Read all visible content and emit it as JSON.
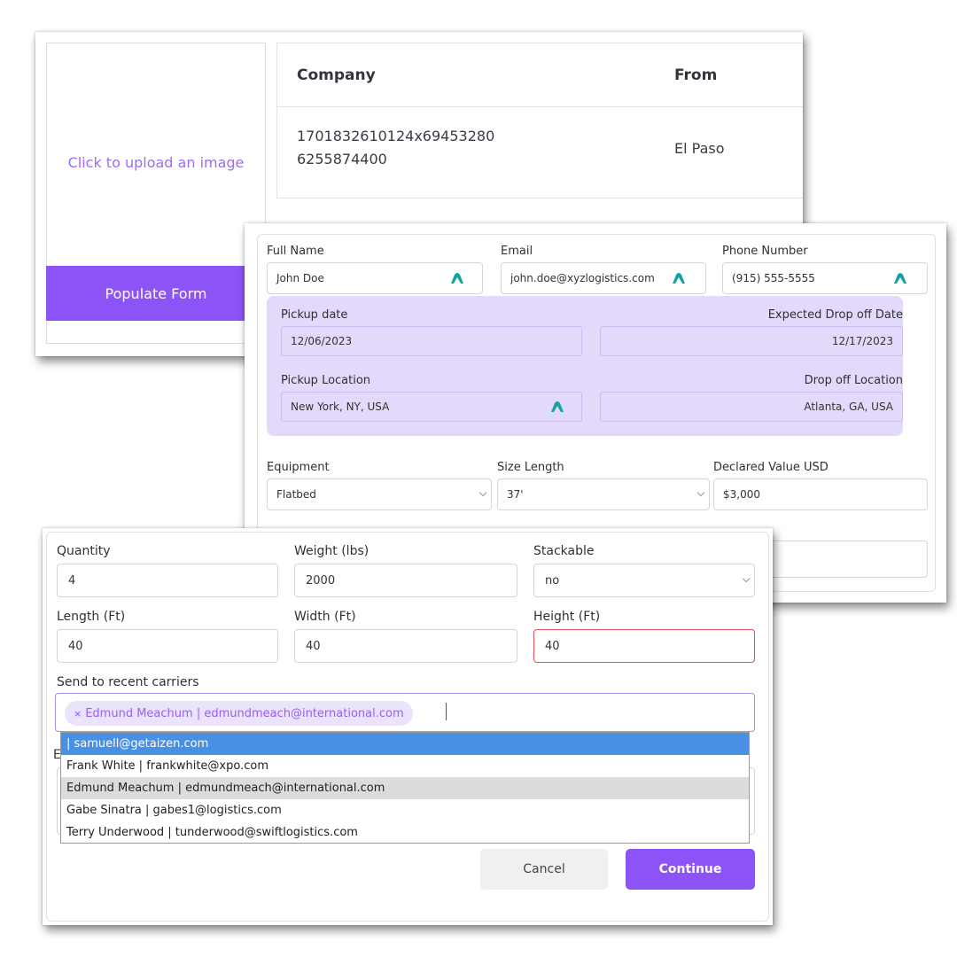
{
  "upload_panel": {
    "prompt": "Click to upload an image",
    "populate_button": "Populate Form"
  },
  "results_table": {
    "columns": [
      "Company",
      "From"
    ],
    "rows": [
      {
        "company_line1": "1701832610124x69453280",
        "company_line2": "6255874400",
        "from": "El Paso"
      }
    ]
  },
  "contact": {
    "full_name_label": "Full Name",
    "full_name": "John Doe",
    "email_label": "Email",
    "email": "john.doe@xyzlogistics.com",
    "phone_label": "Phone Number",
    "phone": "(915) 555-5555"
  },
  "schedule": {
    "pickup_date_label": "Pickup date",
    "pickup_date": "12/06/2023",
    "dropoff_date_label": "Expected Drop off Date",
    "dropoff_date": "12/17/2023",
    "pickup_location_label": "Pickup Location",
    "pickup_location": "New York, NY, USA",
    "dropoff_location_label": "Drop off Location",
    "dropoff_location": "Atlanta, GA, USA"
  },
  "shipment": {
    "equipment_label": "Equipment",
    "equipment": "Flatbed",
    "size_length_label": "Size Length",
    "size_length": "37'",
    "declared_value_label": "Declared Value USD",
    "declared_value": "$3,000"
  },
  "cargo": {
    "quantity_label": "Quantity",
    "quantity": "4",
    "weight_label": "Weight (lbs)",
    "weight": "2000",
    "stackable_label": "Stackable",
    "stackable": "no",
    "length_label": "Length (Ft)",
    "length": "40",
    "width_label": "Width (Ft)",
    "width": "40",
    "height_label": "Height (Ft)",
    "height": "40"
  },
  "carriers": {
    "label": "Send to recent carriers",
    "selected_chip": "Edmund Meachum | edmundmeach@international.com",
    "options": [
      "| samuell@getaizen.com",
      "Frank White | frankwhite@xpo.com",
      "Edmund Meachum | edmundmeach@international.com",
      "Gabe Sinatra | gabes1@logistics.com",
      "Terry Underwood | tunderwood@swiftlogistics.com"
    ],
    "hidden_label_fragment": "E"
  },
  "actions": {
    "cancel": "Cancel",
    "continue": "Continue"
  },
  "colors": {
    "accent": "#8c54f7",
    "panel": "#e2d9fb",
    "icon": "#17a2a2",
    "error": "#e34d5c",
    "highlight": "#4a90e2"
  }
}
